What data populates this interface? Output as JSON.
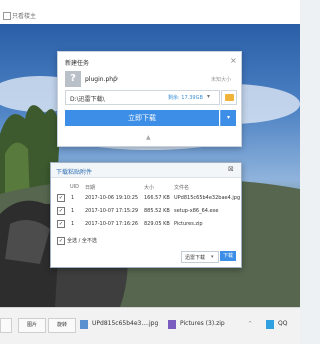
{
  "page": {
    "title": "只看楼主"
  },
  "new_task": {
    "title": "新建任务",
    "file_name": "plugin.php",
    "file_size": "未知大小",
    "path": "D:\\迅雷下载\\",
    "free_space": "剩余: 17.39GB",
    "download_label": "立即下载"
  },
  "clipboard": {
    "title": "下载粘贴附件",
    "columns": [
      "UID",
      "日期",
      "大小",
      "文件名"
    ],
    "rows": [
      {
        "checked": "✓",
        "uid": "1",
        "date": "2017-10-06 19:10:25",
        "size": "166.57 KB",
        "name": "UPd815c65b4e32bae4.jpg"
      },
      {
        "checked": "✓",
        "uid": "1",
        "date": "2017-10-07 17:15:29",
        "size": "885.52 KB",
        "name": "setup-x86_64.exe"
      },
      {
        "checked": "✓",
        "uid": "1",
        "date": "2017-10-07 17:16:26",
        "size": "829.05 KB",
        "name": "Pictures.zip"
      }
    ],
    "select_all": "全选 / 全不选",
    "select_all_checked": "✓",
    "downloader": "迅雷下载",
    "download_button": "下载"
  },
  "taskbar": {
    "btn1": "图片",
    "btn2": "旋转",
    "item1": "UPd815c65b4e3....jpg",
    "item2": "Pictures (3).zip",
    "item3": "QQ"
  }
}
